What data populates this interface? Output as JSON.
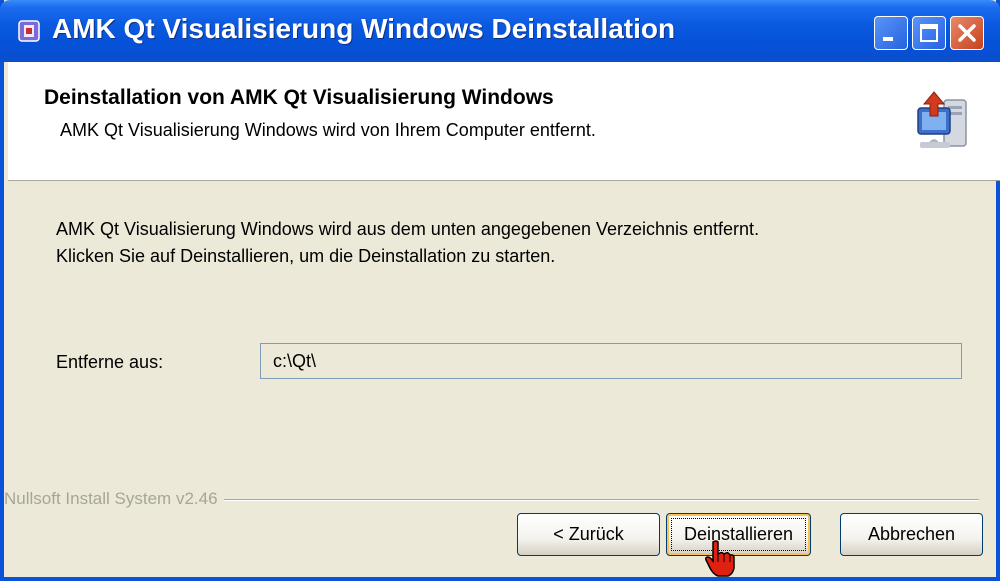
{
  "window": {
    "title": "AMK Qt Visualisierung Windows Deinstallation"
  },
  "header": {
    "title": "Deinstallation von AMK Qt Visualisierung Windows",
    "subtitle": "AMK Qt Visualisierung Windows wird von Ihrem Computer entfernt."
  },
  "body": {
    "line1": "AMK Qt Visualisierung Windows wird aus dem unten angegebenen Verzeichnis entfernt.",
    "line2": "Klicken Sie auf Deinstallieren, um die Deinstallation zu starten."
  },
  "remove_from": {
    "label": "Entferne aus:",
    "value": "c:\\Qt\\"
  },
  "footer": {
    "branding": "Nullsoft Install System v2.46"
  },
  "buttons": {
    "back": "< Zurück",
    "uninstall": "Deinstallieren",
    "cancel": "Abbrechen"
  },
  "colors": {
    "titlebar": "#0a5ae0",
    "dialog_bg": "#ece9d8",
    "close_button": "#c7401c"
  }
}
